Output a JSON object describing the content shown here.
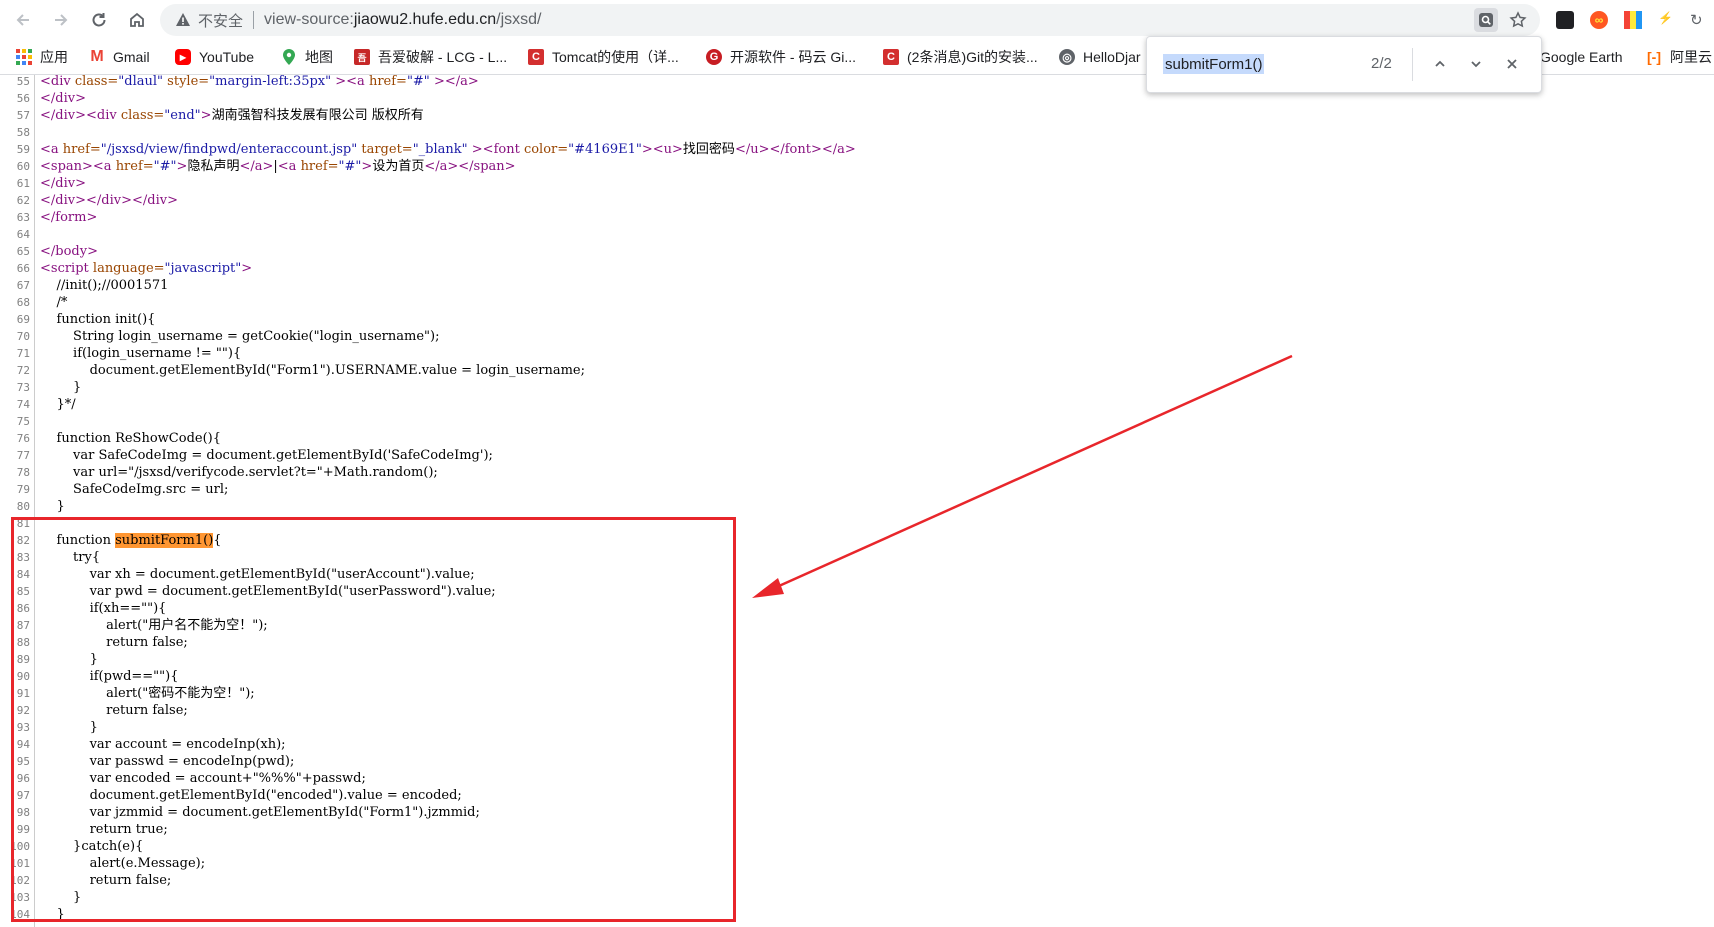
{
  "browser": {
    "security_label": "不安全",
    "url_prefix": "view-source:",
    "url_host": "jiaowu2.hufe.edu.cn",
    "url_path": "/jsxsd/"
  },
  "bookmarks": [
    {
      "label": "应用",
      "icon": "apps-grid-icon",
      "color": "#ea4335"
    },
    {
      "label": "Gmail",
      "icon": "gmail-icon",
      "color": "#ea4335"
    },
    {
      "label": "YouTube",
      "icon": "youtube-icon",
      "color": "#ff0000"
    },
    {
      "label": "地图",
      "icon": "maps-pin-icon",
      "color": "#34a853"
    },
    {
      "label": "吾爱破解 - LCG - L...",
      "icon": "site-icon",
      "color": "#c62828"
    },
    {
      "label": "Tomcat的使用（详...",
      "icon": "csdn-icon",
      "color": "#d32f2f"
    },
    {
      "label": "开源软件 - 码云 Gi...",
      "icon": "gitee-icon",
      "color": "#c71d23"
    },
    {
      "label": "(2条消息)Git的安装...",
      "icon": "csdn-icon",
      "color": "#d32f2f"
    },
    {
      "label": "HelloDjar",
      "icon": "globe-icon",
      "color": "#5f6368"
    },
    {
      "label": "Google Earth",
      "icon": "",
      "color": ""
    },
    {
      "label": "阿里云",
      "icon": "aliyun-icon",
      "color": "#ff6a00"
    }
  ],
  "find_bar": {
    "query": "submitForm1()",
    "result_count": "2/2"
  },
  "source_lines": [
    {
      "n": "55",
      "html": "<span class=\"tag\">&lt;div</span> <span class=\"attr\">class=</span><span class=\"val\">\"dlaul\"</span> <span class=\"attr\">style=</span><span class=\"val\">\"margin-left:35px\"</span> <span class=\"tag\">&gt;&lt;a</span> <span class=\"attr\">href=</span><span class=\"val\">\"#\"</span> <span class=\"tag\">&gt;&lt;/a&gt;</span>"
    },
    {
      "n": "56",
      "html": "<span class=\"tag\">&lt;/div&gt;</span>"
    },
    {
      "n": "57",
      "html": "<span class=\"tag\">&lt;/div&gt;&lt;div</span> <span class=\"attr\">class=</span><span class=\"val\">\"end\"</span><span class=\"tag\">&gt;</span>湖南强智科技发展有限公司 版权所有"
    },
    {
      "n": "58",
      "html": ""
    },
    {
      "n": "59",
      "html": "<span class=\"tag\">&lt;a</span> <span class=\"attr\">href=</span><span class=\"val\">\"/jsxsd/view/findpwd/enteraccount.jsp\"</span> <span class=\"attr\">target=</span><span class=\"val\">\"_blank\"</span> <span class=\"tag\">&gt;&lt;font</span> <span class=\"attr\">color=</span><span class=\"val\">\"#4169E1\"</span><span class=\"tag\">&gt;&lt;u&gt;</span>找回密码<span class=\"tag\">&lt;/u&gt;&lt;/font&gt;&lt;/a&gt;</span>"
    },
    {
      "n": "60",
      "html": "<span class=\"tag\">&lt;span&gt;&lt;a</span> <span class=\"attr\">href=</span><span class=\"val\">\"#\"</span><span class=\"tag\">&gt;</span>隐私声明<span class=\"tag\">&lt;/a&gt;</span>|<span class=\"tag\">&lt;a</span> <span class=\"attr\">href=</span><span class=\"val\">\"#\"</span><span class=\"tag\">&gt;</span>设为首页<span class=\"tag\">&lt;/a&gt;&lt;/span&gt;</span>"
    },
    {
      "n": "61",
      "html": "<span class=\"tag\">&lt;/div&gt;</span>"
    },
    {
      "n": "62",
      "html": "<span class=\"tag\">&lt;/div&gt;&lt;/div&gt;&lt;/div&gt;</span>"
    },
    {
      "n": "63",
      "html": "<span class=\"tag\">&lt;/form&gt;</span>"
    },
    {
      "n": "64",
      "html": ""
    },
    {
      "n": "65",
      "html": "<span class=\"tag\">&lt;/body&gt;</span>"
    },
    {
      "n": "66",
      "html": "<span class=\"tag\">&lt;script</span> <span class=\"attr\">language=</span><span class=\"val\">\"javascript\"</span><span class=\"tag\">&gt;</span>"
    },
    {
      "n": "67",
      "html": "    //init();//0001571"
    },
    {
      "n": "68",
      "html": "    /*"
    },
    {
      "n": "69",
      "html": "    function init(){"
    },
    {
      "n": "70",
      "html": "        String login_username = getCookie(\"login_username\");"
    },
    {
      "n": "71",
      "html": "        if(login_username != \"\"){"
    },
    {
      "n": "72",
      "html": "            document.getElementById(\"Form1\").USERNAME.value = login_username;"
    },
    {
      "n": "73",
      "html": "        }"
    },
    {
      "n": "74",
      "html": "    }*/"
    },
    {
      "n": "75",
      "html": ""
    },
    {
      "n": "76",
      "html": "    function ReShowCode(){"
    },
    {
      "n": "77",
      "html": "        var SafeCodeImg = document.getElementById('SafeCodeImg');"
    },
    {
      "n": "78",
      "html": "        var url=\"/jsxsd/verifycode.servlet?t=\"+Math.random();"
    },
    {
      "n": "79",
      "html": "        SafeCodeImg.src = url;"
    },
    {
      "n": "80",
      "html": "    }"
    },
    {
      "n": "81",
      "html": ""
    },
    {
      "n": "82",
      "html": "    function <span class=\"hl\">submitForm1()</span>{"
    },
    {
      "n": "83",
      "html": "        try{"
    },
    {
      "n": "84",
      "html": "            var xh = document.getElementById(\"userAccount\").value;"
    },
    {
      "n": "85",
      "html": "            var pwd = document.getElementById(\"userPassword\").value;"
    },
    {
      "n": "86",
      "html": "            if(xh==\"\"){"
    },
    {
      "n": "87",
      "html": "                alert(\"用户名不能为空！\");"
    },
    {
      "n": "88",
      "html": "                return false;"
    },
    {
      "n": "89",
      "html": "            }"
    },
    {
      "n": "90",
      "html": "            if(pwd==\"\"){"
    },
    {
      "n": "91",
      "html": "                alert(\"密码不能为空！\");"
    },
    {
      "n": "92",
      "html": "                return false;"
    },
    {
      "n": "93",
      "html": "            }"
    },
    {
      "n": "94",
      "html": "            var account = encodeInp(xh);"
    },
    {
      "n": "95",
      "html": "            var passwd = encodeInp(pwd);"
    },
    {
      "n": "96",
      "html": "            var encoded = account+\"%%%\"+passwd;"
    },
    {
      "n": "97",
      "html": "            document.getElementById(\"encoded\").value = encoded;"
    },
    {
      "n": "98",
      "html": "            var jzmmid = document.getElementById(\"Form1\").jzmmid;"
    },
    {
      "n": "99",
      "html": "            return true;"
    },
    {
      "n": "100",
      "html": "        }catch(e){"
    },
    {
      "n": "101",
      "html": "            alert(e.Message);"
    },
    {
      "n": "102",
      "html": "            return false;"
    },
    {
      "n": "103",
      "html": "        }"
    },
    {
      "n": "104",
      "html": "    }"
    }
  ],
  "annotation_color": "#e8262b"
}
